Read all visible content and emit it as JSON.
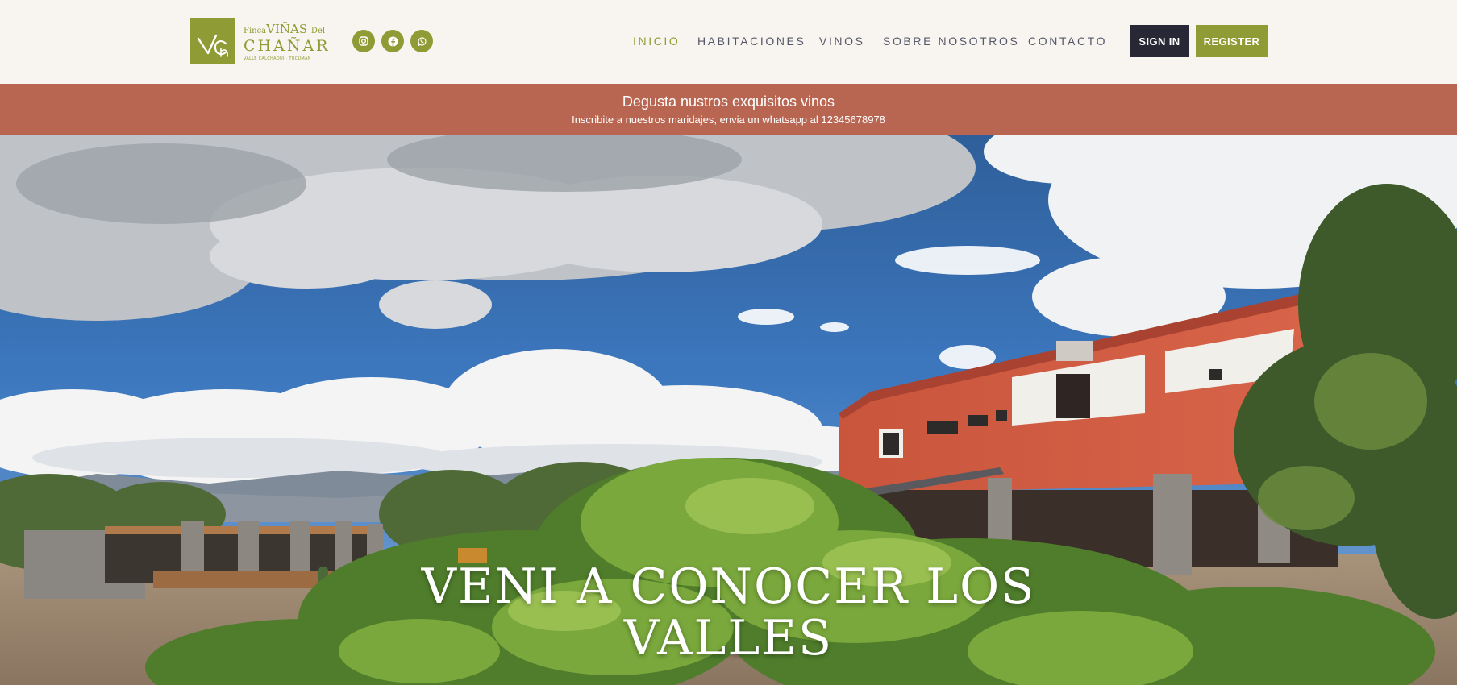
{
  "brand": {
    "finca": "Finca",
    "vinas": "VIÑAS",
    "del": "Del",
    "chanar": "CHAÑAR",
    "tagline": "VALLE CALCHAQUÍ · TUCUMÁN",
    "monogram": "VCh",
    "primary_color": "#8f9b34"
  },
  "social": [
    {
      "icon": "instagram-icon"
    },
    {
      "icon": "facebook-icon"
    },
    {
      "icon": "whatsapp-icon"
    }
  ],
  "nav": {
    "items": [
      {
        "label": "INICIO",
        "active": true
      },
      {
        "label": "HABITACIONES",
        "active": false
      },
      {
        "label": "VINOS",
        "active": false
      },
      {
        "label": "SOBRE NOSOTROS",
        "active": false
      },
      {
        "label": "CONTACTO",
        "active": false
      }
    ]
  },
  "auth": {
    "signin_label": "SIGN IN",
    "register_label": "REGISTER"
  },
  "banner": {
    "title": "Degusta nustros exquisitos vinos",
    "subtitle": "Inscribite a nuestros maridajes, envia un whatsapp al 12345678978",
    "color": "#b86651"
  },
  "hero": {
    "heading_line1": "VENI A CONOCER LOS",
    "heading_line2": "VALLES"
  }
}
